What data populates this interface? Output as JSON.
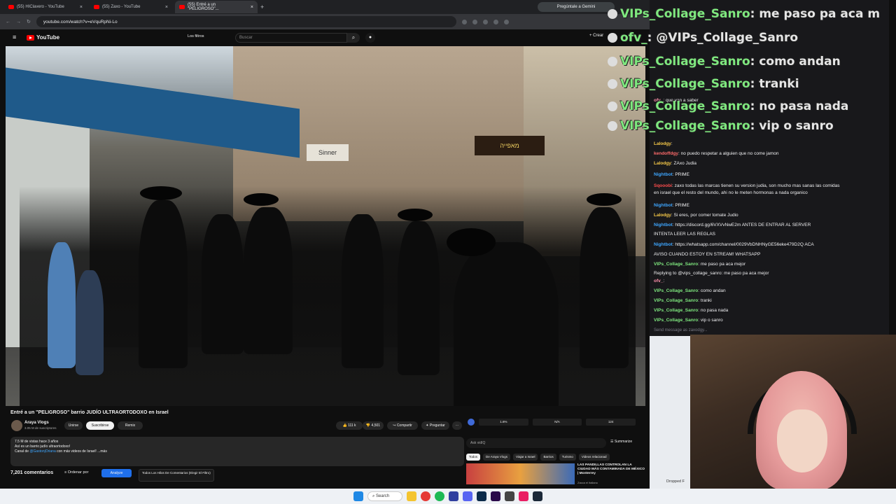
{
  "browser": {
    "tabs": [
      {
        "label": "(55) HIClavero - YouTube"
      },
      {
        "label": "(55) Zaxo - YouTube"
      },
      {
        "label": "(55) Entré a un \"PELIGROSO\"..."
      }
    ],
    "url": "youtube.com/watch?v=eVquRpNi-Lo",
    "gemini_label": "Pregúntale a Gemini"
  },
  "masthead": {
    "logo_text": "YouTube",
    "filters_label": "Los filtros",
    "search_placeholder": "Buscar",
    "create_label": "Crear"
  },
  "video": {
    "shop_sign": "Sinner",
    "bakery_sign": "מאפייה"
  },
  "info": {
    "title": "Entré a un \"PELIGROSO\" barrio JUDÍO ULTRAORTODOXO en Israel",
    "channel": "Araya Vlogs",
    "subscribers": "3.05 M de suscriptores",
    "join_label": "Unirse",
    "subscribe_label": "Suscribirse",
    "remix_label": "Remix",
    "likes": "111 k",
    "dislikes": "4,501",
    "share_label": "Compartir",
    "ask_label": "Preguntar",
    "desc_line1": "7.5 M de vistas  hace 3 años",
    "desc_line2": "Así es un barrio judío ultraortodoxo!",
    "desc_line3_pre": "Canal de ",
    "desc_link": "@GastonjOriana",
    "desc_line3_post": " con más videos de Israel! ...más",
    "comments_count": "7,201 comentarios",
    "sort_label": "Ordenar por",
    "analyze_label": "Analyze",
    "todos_label": "Todos Los Hilos De Comentarios (Elegir El Filtro)"
  },
  "side": {
    "stats": [
      "1.6%",
      "N/A",
      "124"
    ],
    "ask_placeholder": "Ask vidIQ",
    "summarize_label": "Summarize",
    "chips": [
      "Todos",
      "De Araya Vlogs",
      "Viajar a Israel",
      "Barrios",
      "Turismo",
      "Videos relacionad"
    ],
    "rec_title": "LAS PANDILLAS CONTROLAN LA CIUDAD MÁS CONTAMINADA DE MÉXICO | Monterrey",
    "rec_channel": "Zacca el italiano"
  },
  "chat": {
    "big": [
      {
        "name": "VIPs_Collage_Sanro",
        "text": ": me paso pa aca m"
      },
      {
        "name": "ofv_",
        "text": ": @VIPs_Collage_Sanro"
      },
      {
        "name": "VIPs_Collage_Sanro",
        "text": ": como andan"
      },
      {
        "name": "VIPs_Collage_Sanro",
        "text": ": tranki"
      },
      {
        "name": "VIPs_Collage_Sanro",
        "text": ": no pasa nada"
      },
      {
        "name": "VIPs_Collage_Sanro",
        "text": ": vip o sanro"
      }
    ],
    "messages": [
      {
        "user": "ofv_",
        "text": ": que van a saber"
      },
      {
        "user": "Lalodgy",
        "text": ":"
      },
      {
        "user": "kendoffdgy",
        "text": ": no puedo respetar a alguien que no come jamon"
      },
      {
        "user": "Lalodgy",
        "text": ": ZAxo Judia"
      },
      {
        "user": "Nightbot",
        "text": ": PRIME"
      },
      {
        "user": "Sqooobi",
        "text": ": zaxo todas las marcas tienen su version judia, son mucho mas sanas las comidas"
      },
      {
        "user": "",
        "text": "en israel que el resto del mundo, ahi no le meten hormonas a nada organico"
      },
      {
        "user": "Nightbot",
        "text": ": PRIME"
      },
      {
        "user": "Lalodgy",
        "text": ": Si eres, por comer tomate Judio"
      },
      {
        "user": "Nightbot",
        "text": ": https://discord.gg/6VXVvNwE2m ANTES DE ENTRAR AL SERVER"
      },
      {
        "user": "",
        "text": "INTENTA LEER LAS REGLAS"
      },
      {
        "user": "Nightbot",
        "text": ": https://whatsapp.com/channel/0029VbDNHNyGE56eke479D2Q ACA"
      },
      {
        "user": "",
        "text": "AVISO CUANDO ESTOY EN STREAM! WHATSAPP"
      },
      {
        "user": "VIPs_Collage_Sanro",
        "text": ": me paso pa aca mejor"
      },
      {
        "user": "",
        "text": "Replying to @vips_collage_sanro: me paso pa aca mejor"
      },
      {
        "user": "ofv_",
        "text": ":"
      },
      {
        "user": "VIPs_Collage_Sanro",
        "text": ": como andan"
      },
      {
        "user": "VIPs_Collage_Sanro",
        "text": ": tranki"
      },
      {
        "user": "VIPs_Collage_Sanro",
        "text": ": no pasa nada"
      },
      {
        "user": "VIPs_Collage_Sanro",
        "text": ": vip o sanro"
      }
    ],
    "input_placeholder": "Send message as zaxodgy..."
  },
  "desktop": {
    "dropped_label": "Dropped F"
  },
  "taskbar": {
    "search_label": "Search"
  }
}
